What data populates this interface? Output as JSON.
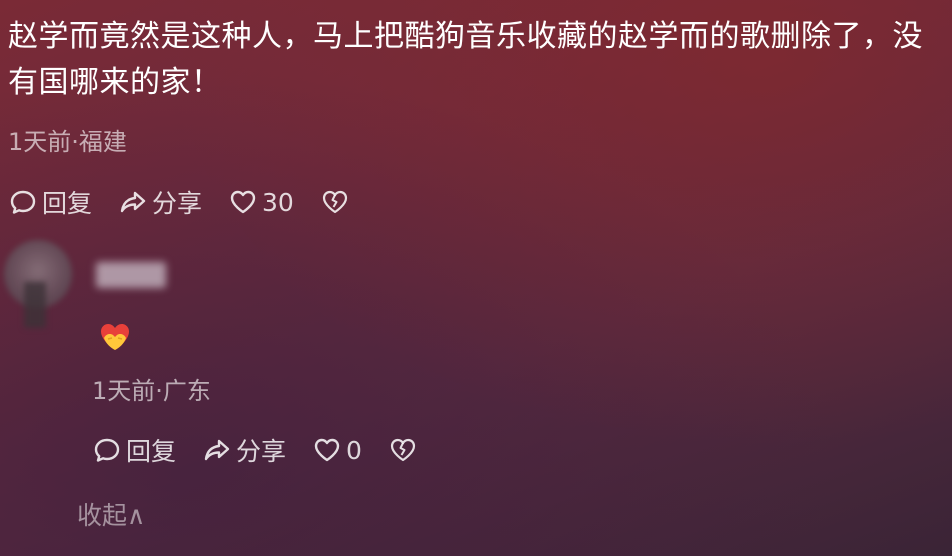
{
  "comment": {
    "text": "赵学而竟然是这种人，马上把酷狗音乐收藏的赵学而的歌删除了，没有国哪来的家！",
    "meta": "1天前·福建",
    "actions": {
      "reply": "回复",
      "share": "分享",
      "like_count": "30"
    }
  },
  "reply": {
    "meta": "1天前·广东",
    "actions": {
      "reply": "回复",
      "share": "分享",
      "like_count": "0"
    }
  },
  "collapse_label": "收起∧",
  "icons": {
    "reply": "speech-bubble-icon",
    "share": "share-arrow-icon",
    "like": "heart-icon",
    "dislike": "broken-heart-icon",
    "emoji": "heart-hands-emoji"
  },
  "colors": {
    "text": "#ffffff",
    "muted": "#c7b6bc",
    "background": "#6e2a3c"
  }
}
